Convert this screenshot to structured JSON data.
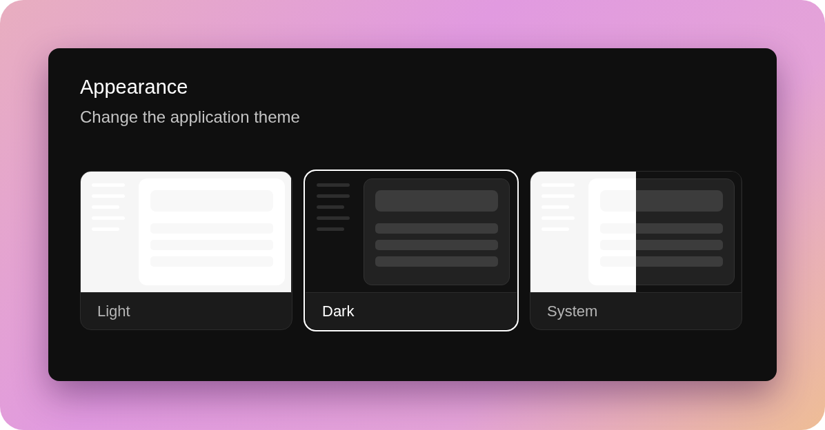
{
  "panel": {
    "title": "Appearance",
    "subtitle": "Change the application theme"
  },
  "themes": [
    {
      "kind": "light",
      "label": "Light",
      "selected": false
    },
    {
      "kind": "dark",
      "label": "Dark",
      "selected": true
    },
    {
      "kind": "system",
      "label": "System",
      "selected": false
    }
  ]
}
